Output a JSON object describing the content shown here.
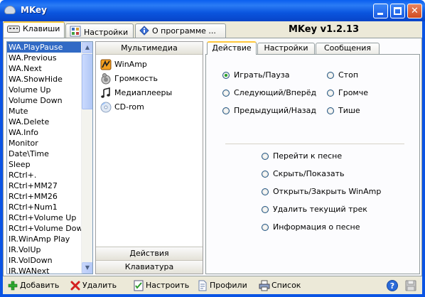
{
  "window": {
    "title": "MKey",
    "buttons": [
      "minimize",
      "maximize",
      "close"
    ],
    "close_glyph": "✕"
  },
  "top_tabs": [
    {
      "label": "Клавиши",
      "icon": "keyboard-icon",
      "active": true
    },
    {
      "label": "Настройки",
      "icon": "settings-icon",
      "active": false
    },
    {
      "label": "О программе ...",
      "icon": "info-icon",
      "active": false
    }
  ],
  "app_version": "MKey v1.2.13",
  "key_list": {
    "selected": "WA.PlayPause",
    "items": [
      "WA.PlayPause",
      "WA.Previous",
      "WA.Next",
      "WA.ShowHide",
      "Volume Up",
      "Volume Down",
      "Mute",
      "WA.Delete",
      "WA.Info",
      "Monitor",
      "Date\\Time",
      "Sleep",
      "RCtrl+.",
      "RCtrl+MM27",
      "RCtrl+MM26",
      "RCtrl+Num1",
      "RCtrl+Volume Up",
      "RCtrl+Volume Down",
      "IR.WinAmp Play",
      "IR.VolUp",
      "IR.VolDown",
      "IR.WANext"
    ],
    "scroll_up": "▲",
    "scroll_down": "▼"
  },
  "categories": {
    "header": "Мультимедиа",
    "items": [
      {
        "label": "WinAmp",
        "icon": "winamp-icon"
      },
      {
        "label": "Громкость",
        "icon": "speaker-icon"
      },
      {
        "label": "Медиаплееры",
        "icon": "music-note-icon"
      },
      {
        "label": "CD-rom",
        "icon": "cd-icon"
      }
    ],
    "footer": [
      "Действия",
      "Клавиатура"
    ]
  },
  "action_tabs": [
    {
      "label": "Действие",
      "active": true
    },
    {
      "label": "Настройки",
      "active": false
    },
    {
      "label": "Сообщения",
      "active": false
    }
  ],
  "actions": {
    "group1": [
      {
        "label": "Играть/Пауза",
        "checked": true
      },
      {
        "label": "Стоп",
        "checked": false
      },
      {
        "label": "Следующий/Вперёд",
        "checked": false
      },
      {
        "label": "Громче",
        "checked": false
      },
      {
        "label": "Предыдущий/Назад",
        "checked": false
      },
      {
        "label": "Тише",
        "checked": false
      }
    ],
    "group2": [
      {
        "label": "Перейти к песне",
        "checked": false
      },
      {
        "label": "Скрыть/Показать",
        "checked": false
      },
      {
        "label": "Открыть/Закрыть WinAmp",
        "checked": false
      },
      {
        "label": "Удалить текущий трек",
        "checked": false
      },
      {
        "label": "Информация о песне",
        "checked": false
      }
    ]
  },
  "toolbar": {
    "add": "Добавить",
    "delete": "Удалить",
    "configure": "Настроить",
    "profiles": "Профили",
    "list": "Список",
    "help_glyph": "?"
  },
  "colors": {
    "selection": "#316ac5",
    "title_bar": "#0a54e4",
    "tab_highlight": "#ffc83c"
  }
}
